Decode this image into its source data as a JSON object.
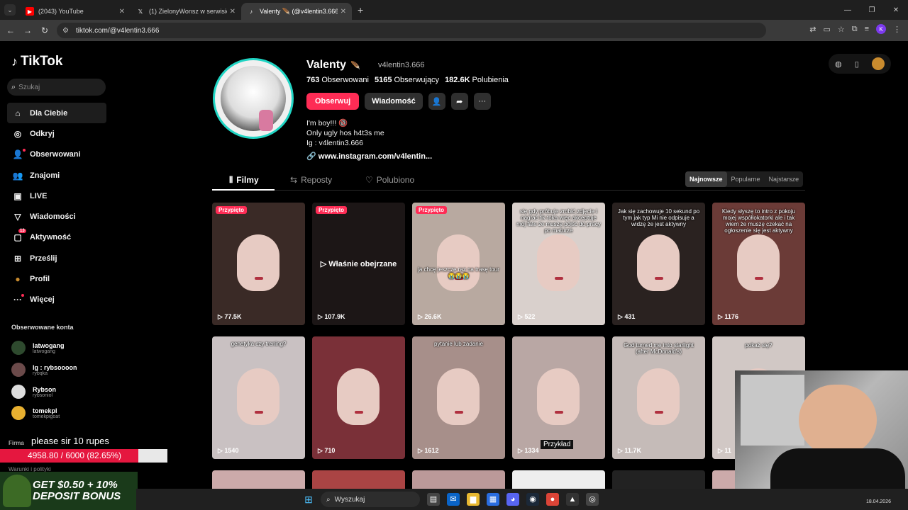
{
  "browser": {
    "tabs": [
      {
        "title": "(2043) YouTube",
        "favicon_color": "#ff0000"
      },
      {
        "title": "(1) ZielonyWonsz w serwisie X:",
        "favicon_color": "#ffffff"
      },
      {
        "title": "Valenty 🪶 (@v4lentin3.666)",
        "favicon_color": "#ffffff"
      }
    ],
    "url": "tiktok.com/@v4lentin3.666"
  },
  "sidebar": {
    "logo": "TikTok",
    "search_placeholder": "Szukaj",
    "items": [
      {
        "label": "Dla Ciebie",
        "icon": "home-icon"
      },
      {
        "label": "Odkryj",
        "icon": "compass-icon"
      },
      {
        "label": "Obserwowani",
        "icon": "following-icon"
      },
      {
        "label": "Znajomi",
        "icon": "friends-icon"
      },
      {
        "label": "LIVE",
        "icon": "live-icon"
      },
      {
        "label": "Wiadomości",
        "icon": "messages-icon"
      },
      {
        "label": "Aktywność",
        "icon": "activity-icon",
        "badge": "13"
      },
      {
        "label": "Prześlij",
        "icon": "upload-icon"
      },
      {
        "label": "Profil",
        "icon": "profile-icon"
      },
      {
        "label": "Więcej",
        "icon": "more-icon"
      }
    ],
    "followed_title": "Obserwowane konta",
    "followed": [
      {
        "name": "latwogang",
        "handle": "latwogang"
      },
      {
        "name": "Ig : rybsoooon",
        "handle": "rybqka"
      },
      {
        "name": "Rybson",
        "handle": "rybsoniol"
      },
      {
        "name": "tomekpl",
        "handle": "tomekpigoat"
      }
    ],
    "footer_firma": "Firma",
    "footer_warunki": "Warunki i polityki"
  },
  "stream_overlay": {
    "message": "please sir 10 rupes",
    "progress_text": "4958.80 / 6000 (82.65%)",
    "progress_fraction": 0.8265,
    "promo": "GET $0.50 + 10% DEPOSIT BONUS"
  },
  "profile": {
    "name": "Valenty",
    "name_emoji": "🪶",
    "handle": "v4lentin3.666",
    "following_count": "763",
    "following_label": "Obserwowani",
    "followers_count": "5165",
    "followers_label": "Obserwujący",
    "likes_count": "182.6K",
    "likes_label": "Polubienia",
    "follow_label": "Obserwuj",
    "message_label": "Wiadomość",
    "bio_lines": [
      "I'm boy!!! 🔞",
      "Only ugly hos h4t3s me",
      "Ig : v4lentin3.666"
    ],
    "link": "www.instagram.com/v4lentin..."
  },
  "content_tabs": {
    "videos": "Filmy",
    "reposts": "Reposty",
    "liked": "Polubiono"
  },
  "sort": {
    "newest": "Najnowsze",
    "popular": "Popularne",
    "oldest": "Najstarsze"
  },
  "videos": [
    {
      "views": "77.5K",
      "pinned": "Przypięto",
      "caption": "",
      "bg": "#3a2a26"
    },
    {
      "views": "107.9K",
      "pinned": "Przypięto",
      "caption": "",
      "watched": "Właśnie obejrzane",
      "bg": "#1c1616"
    },
    {
      "views": "26.6K",
      "pinned": "Przypięto",
      "caption": "ja chcę jeszcze raz na trasę tour 😭😭😭",
      "bg": "#b8a9a0"
    },
    {
      "views": "522",
      "pinned": "",
      "caption": "się gdy próbuje zrobić zdjęcie i nagrać tik toka więc akceptuje mój fate że muszę pójść do pracy po maturze",
      "bg": "#d9d0cc"
    },
    {
      "views": "431",
      "pinned": "",
      "caption": "Jak się zachowuje 10 sekund po tym jak typ Mi nie odpisuje a widzę że jest aktywny",
      "bg": "#2a2220"
    },
    {
      "views": "1176",
      "pinned": "",
      "caption": "Kiedy słyszę to intro z pokoju mojej współlokatorki ale i tak wiem że muszę czekać na ogłoszenie się jest aktywny",
      "bg": "#6b3b37"
    },
    {
      "views": "1540",
      "pinned": "",
      "caption": "genetyka czy trening?",
      "bg": "#c9c1c2"
    },
    {
      "views": "710",
      "pinned": "",
      "caption": "",
      "bg": "#7a3038"
    },
    {
      "views": "1612",
      "pinned": "",
      "caption": "pytanie lub zadanie",
      "bg": "#a78f8a"
    },
    {
      "views": "1334",
      "pinned": "",
      "caption": "",
      "tag": "Przykład",
      "bg": "#b9a7a4"
    },
    {
      "views": "11.7K",
      "pinned": "",
      "caption": "God turned me into starlight (after McDonald's)",
      "bg": "#c5bbb8"
    },
    {
      "views": "11",
      "pinned": "",
      "caption": "pokaż się?",
      "bg": "#d1c8c5"
    }
  ],
  "taskbar": {
    "search": "Wyszukaj",
    "date": "18.04.2026"
  },
  "colors": {
    "accent": "#fe2c55",
    "avatar_ring": "#20d5c4"
  }
}
